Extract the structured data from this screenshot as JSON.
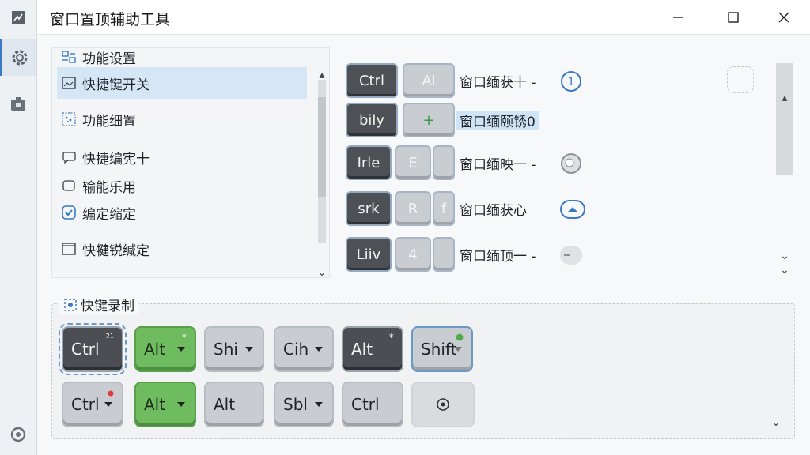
{
  "window": {
    "title": "窗口置顶辅助工具"
  },
  "rail": {
    "items": [
      "app-icon",
      "gear-icon",
      "plugin-icon",
      "refresh-icon"
    ]
  },
  "left_panel": {
    "header": "功能设置",
    "items": [
      {
        "label": "快捷键开关",
        "icon": "image-icon",
        "selected": true
      },
      {
        "label": "功能细置",
        "icon": "dots-icon",
        "selected": false
      },
      {
        "label": "快捷编宪十",
        "icon": "bubble-icon",
        "selected": false
      },
      {
        "label": "输能乐用",
        "icon": "square-icon",
        "selected": false
      },
      {
        "label": "编定缩定",
        "icon": "check-shield-icon",
        "selected": false
      },
      {
        "label": "快犍锐缄定",
        "icon": "window-icon",
        "selected": false
      }
    ]
  },
  "shortcut_rows": [
    {
      "key1": "Ctrl",
      "key2": "Al",
      "label": "窗口缅获十 -",
      "status_icon": "number-one-icon"
    },
    {
      "key1": "bily",
      "key2": "+",
      "label": "窗口缅颐锈0",
      "status_icon": ""
    },
    {
      "key1": "Irle",
      "key2": "E",
      "label": "窗口缅映一 -",
      "status_icon": "record-icon"
    },
    {
      "key1": "srk",
      "key2": "R",
      "key3": "f",
      "label": "窗口缅获心",
      "status_icon": "caret-up-icon"
    },
    {
      "key1": "Liiv",
      "key2": "4",
      "label": "窗口缅顶一 -",
      "status_icon": "toggle-icon"
    }
  ],
  "recording": {
    "legend": "快键录制",
    "row1": [
      {
        "label": "Ctrl",
        "mark": "²¹"
      },
      {
        "label": "Alt",
        "mark": "*"
      },
      {
        "label": "Shi",
        "mark": ""
      },
      {
        "label": "Cih",
        "mark": ""
      },
      {
        "label": "Alt",
        "mark": "*"
      },
      {
        "label": "Shift",
        "mark": ""
      }
    ],
    "row2": [
      {
        "label": "Ctrl",
        "mark": ""
      },
      {
        "label": "Alt",
        "mark": ""
      },
      {
        "label": "Alt",
        "mark": ""
      },
      {
        "label": "Sbl",
        "mark": ""
      },
      {
        "label": "Ctrl",
        "mark": ""
      },
      {
        "label": "",
        "mark": ""
      }
    ]
  },
  "colors": {
    "accent": "#3a79c4",
    "green": "#6fbb60",
    "dark_key": "#4d5155",
    "selection": "#d5e6f7"
  }
}
